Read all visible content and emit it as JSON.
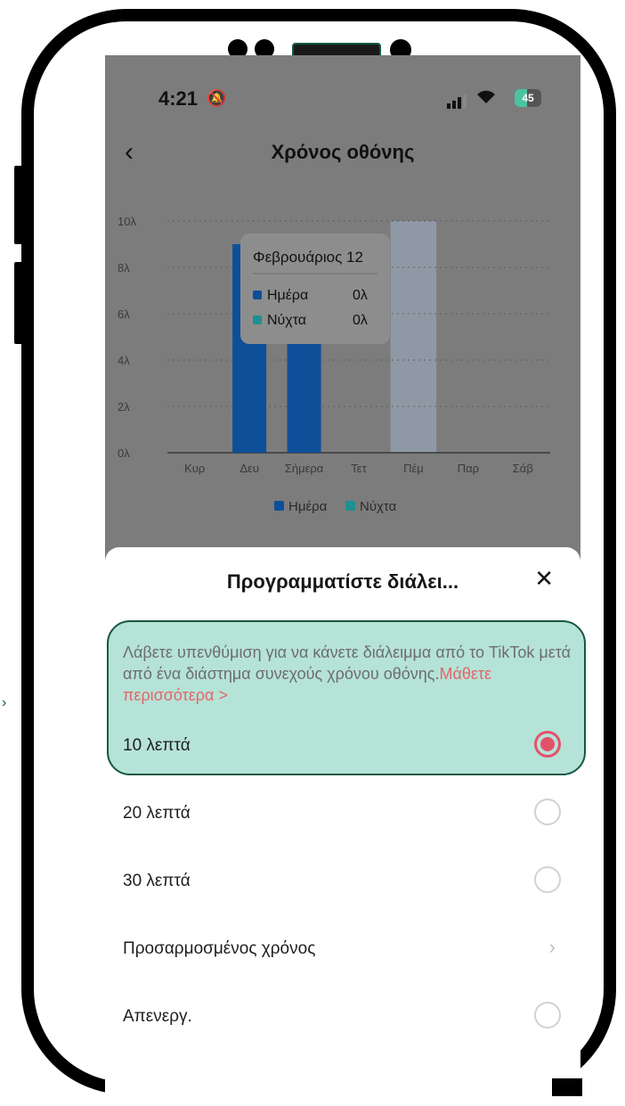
{
  "status": {
    "time": "4:21",
    "battery": "45"
  },
  "header": {
    "title": "Χρόνος οθόνης"
  },
  "chart_data": {
    "type": "bar",
    "categories": [
      "Κυρ",
      "Δευ",
      "Σήμερα",
      "Τετ",
      "Πέμ",
      "Παρ",
      "Σάβ"
    ],
    "series": [
      {
        "name": "Ημέρα",
        "values": [
          0,
          9,
          9,
          0,
          0,
          0,
          0
        ],
        "color": "#0d4f98"
      },
      {
        "name": "Νύχτα",
        "values": [
          0,
          0,
          0,
          0,
          0,
          0,
          0
        ],
        "color": "#1f8f8f"
      }
    ],
    "y_ticks": [
      "0λ",
      "2λ",
      "4λ",
      "6λ",
      "8λ",
      "10λ"
    ],
    "ylim": [
      0,
      10
    ],
    "selected_category_index": 4,
    "tooltip": {
      "title": "Φεβρουάριος 12",
      "rows": [
        {
          "label": "Ημέρα",
          "value": "0λ",
          "color": "#0d4f98"
        },
        {
          "label": "Νύχτα",
          "value": "0λ",
          "color": "#1f8f8f"
        }
      ]
    },
    "legend": [
      {
        "label": "Ημέρα",
        "color": "#0d4f98"
      },
      {
        "label": "Νύχτα",
        "color": "#1f8f8f"
      }
    ]
  },
  "sheet": {
    "title": "Προγραμματίστε διάλει...",
    "description": "Λάβετε υπενθύμιση για να κάνετε διάλειμμα από το TikTok μετά από ένα διάστημα συνεχούς χρόνου οθόνης.",
    "learn_more": "Μάθετε περισσότερα >",
    "options": [
      {
        "label": "10 λεπτά",
        "selected": true
      },
      {
        "label": "20 λεπτά",
        "selected": false
      },
      {
        "label": "30 λεπτά",
        "selected": false
      },
      {
        "label": "Προσαρμοσμένος χρόνος",
        "type": "chevron"
      },
      {
        "label": "Απενεργ.",
        "selected": false
      }
    ]
  }
}
